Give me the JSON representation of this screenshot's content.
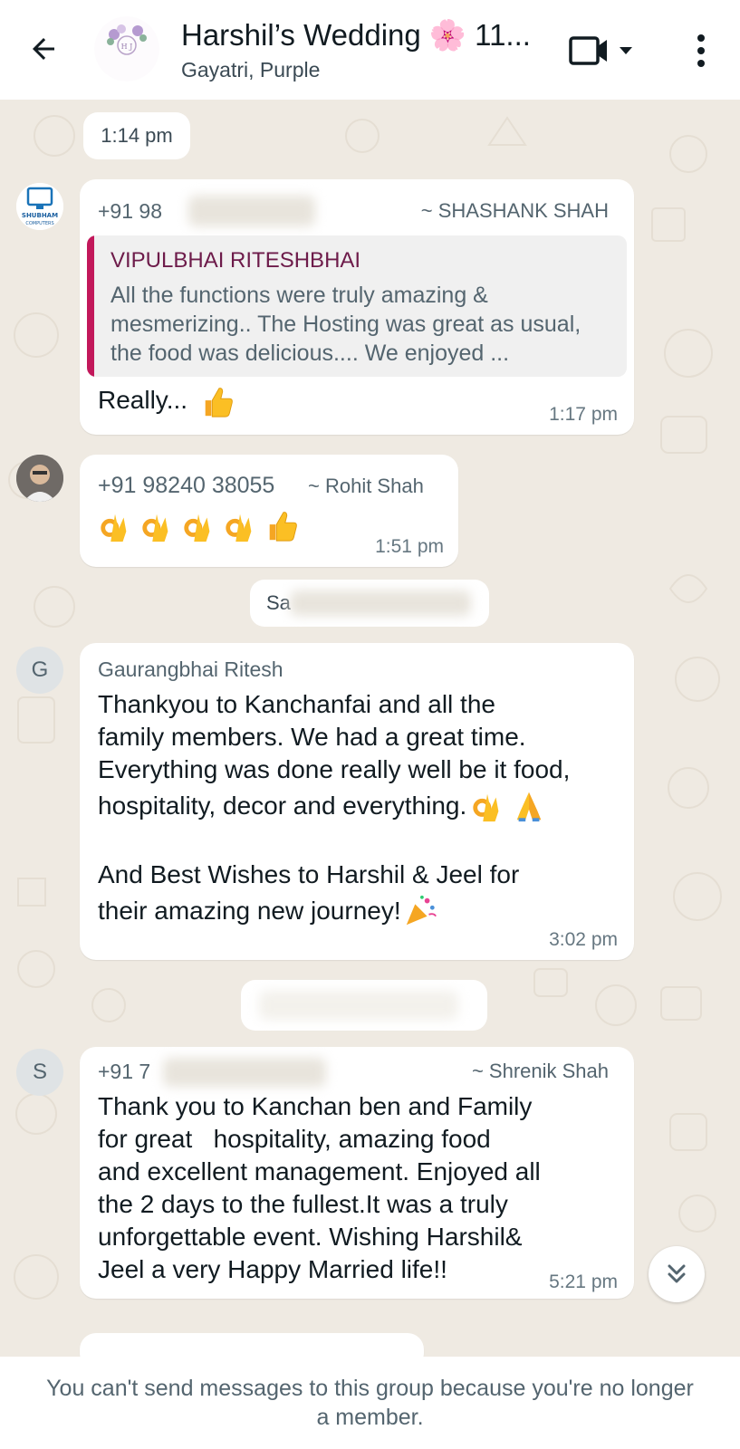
{
  "header": {
    "title": "Harshil’s Wedding 🌸 11...",
    "subtitle": "Gayatri, Purple",
    "avatar_caption": "Harshil & Jeel"
  },
  "messages": [
    {
      "type": "time_pill",
      "text": "1:14 pm"
    },
    {
      "type": "message",
      "phone": "+91 98",
      "alias": "~ SHASHANK SHAH",
      "avatar_label": "SHUBHAM COMPUTERS",
      "quote": {
        "author": "VIPULBHAI RITESHBHAI",
        "text": "All the functions were truly amazing & mesmerizing.. The Hosting was great as usual, the food was delicious.... We enjoyed ..."
      },
      "text": "Really...",
      "time": "1:17 pm"
    },
    {
      "type": "message",
      "phone": "+91 98240 38055",
      "alias": "~ Rohit Shah",
      "time": "1:51 pm"
    },
    {
      "type": "system_pill",
      "text": "Sa"
    },
    {
      "type": "message",
      "avatar_letter": "G",
      "name": "Gaurangbhai Ritesh",
      "text_lines": [
        "Thankyou to Kanchanfai and all the",
        "family members. We had a great time.",
        "Everything was done really well be it food,",
        "hospitality, decor and everything."
      ],
      "text_lines_2": [
        "And Best Wishes to Harshil & Jeel for",
        "their amazing new journey!"
      ],
      "time": "3:02 pm"
    },
    {
      "type": "system_pill",
      "text": ""
    },
    {
      "type": "message",
      "avatar_letter": "S",
      "phone": "+91 7",
      "alias": "~ Shrenik Shah",
      "text_lines": [
        "Thank you to Kanchan ben and Family",
        "for great   hospitality, amazing food",
        "and excellent management. Enjoyed all",
        "the 2 days to the fullest.It was a truly",
        "unforgettable event. Wishing Harshil&",
        "Jeel a very Happy Married life!!"
      ],
      "time": "5:21 pm"
    }
  ],
  "footer": {
    "text": "You can't send messages to this group because you're no longer a member."
  },
  "colors": {
    "wallpaper": "#efeae2",
    "quote_bar": "#c2185b",
    "quote_author": "#6d1b4a"
  }
}
